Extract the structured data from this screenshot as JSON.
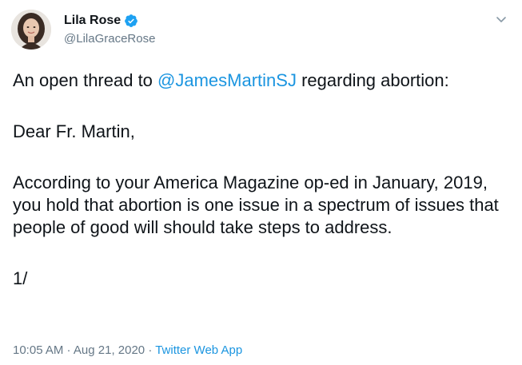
{
  "author": {
    "display_name": "Lila Rose",
    "handle": "@LilaGraceRose",
    "verified": true,
    "avatar_icon": "profile-photo"
  },
  "tweet": {
    "line1_prefix": "An open thread to ",
    "line1_mention": "@JamesMartinSJ",
    "line1_suffix": " regarding abortion:",
    "line2": "Dear Fr. Martin,",
    "line3": "According to your America Magazine op-ed in January, 2019, you hold that abortion is one issue in a spectrum of issues that people of good will should take steps to address.",
    "line4": "1/"
  },
  "meta": {
    "time": "10:05 AM",
    "separator": " · ",
    "date": "Aug 21, 2020",
    "app": "Twitter Web App"
  },
  "colors": {
    "link": "#1b95e0",
    "muted": "#657786",
    "text": "#0f1419",
    "verified": "#1da1f2"
  }
}
